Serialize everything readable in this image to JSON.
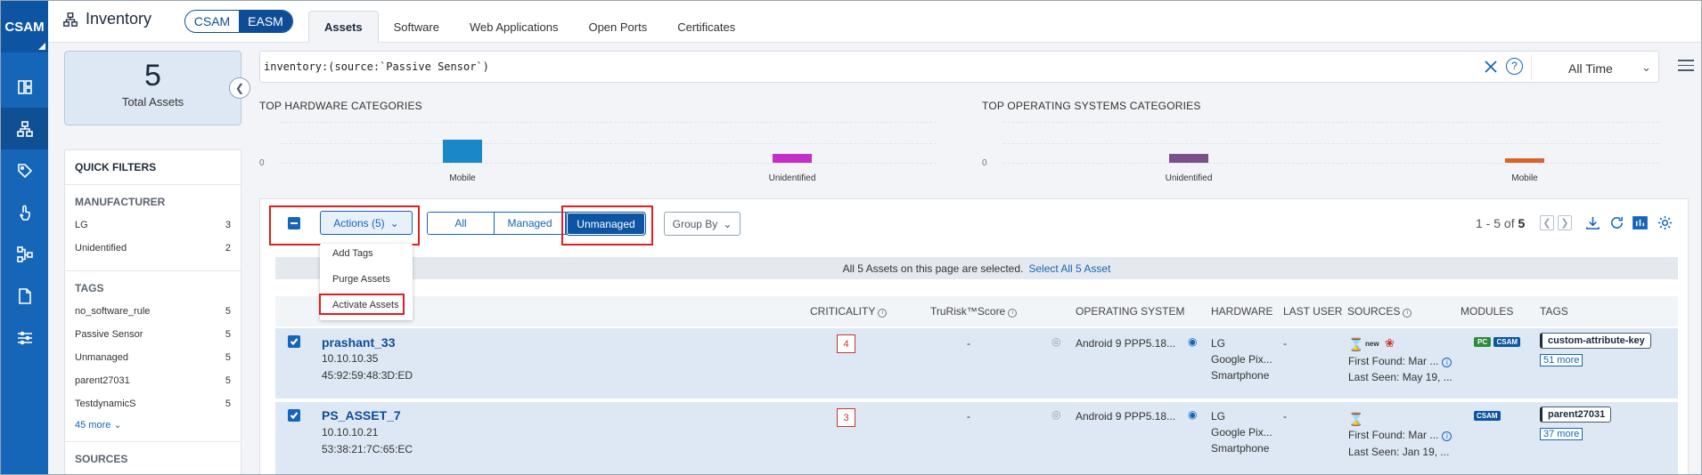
{
  "rail": {
    "logo": "CSAM"
  },
  "header": {
    "title": "Inventory",
    "mode": {
      "csam": "CSAM",
      "easm": "EASM"
    },
    "tabs": [
      "Assets",
      "Software",
      "Web Applications",
      "Open Ports",
      "Certificates"
    ]
  },
  "summary": {
    "total": "5",
    "total_label": "Total Assets"
  },
  "search": {
    "query": "inventory:(source:`Passive Sensor`)",
    "time_range": "All Time"
  },
  "filters": {
    "title": "QUICK FILTERS",
    "manufacturer": {
      "title": "MANUFACTURER",
      "items": [
        {
          "label": "LG",
          "count": "3"
        },
        {
          "label": "Unidentified",
          "count": "2"
        }
      ]
    },
    "tags": {
      "title": "TAGS",
      "items": [
        {
          "label": "no_software_rule",
          "count": "5"
        },
        {
          "label": "Passive Sensor",
          "count": "5"
        },
        {
          "label": "Unmanaged",
          "count": "5"
        },
        {
          "label": "parent27031",
          "count": "5"
        },
        {
          "label": "TestdynamicS",
          "count": "5"
        }
      ],
      "more": "45 more"
    },
    "sources_title": "SOURCES"
  },
  "charts": {
    "hardware": {
      "title": "TOP HARDWARE CATEGORIES",
      "zero": "0",
      "bars": [
        {
          "label": "Mobile",
          "value": 3,
          "color": "#1a87c9"
        },
        {
          "label": "Unidentified",
          "value": 1.2,
          "color": "#c42fc7"
        }
      ]
    },
    "os": {
      "title": "TOP OPERATING SYSTEMS CATEGORIES",
      "zero": "0",
      "bars": [
        {
          "label": "Unidentified",
          "value": 1.2,
          "color": "#7b4f8a"
        },
        {
          "label": "Mobile",
          "value": 0.6,
          "color": "#d8642a"
        }
      ]
    }
  },
  "toolbar": {
    "actions": "Actions (5)",
    "segments": [
      "All",
      "Managed",
      "Unmanaged"
    ],
    "group_by": "Group By",
    "pager_prefix": "1 - 5 of",
    "pager_total": "5"
  },
  "actions_menu": [
    "Add Tags",
    "Purge Assets",
    "Activate Assets"
  ],
  "selection": {
    "text": "All 5 Assets on this page are selected.",
    "link": "Select All 5 Asset"
  },
  "columns": {
    "criticality": "CRITICALITY",
    "trurisk": "TruRisk™Score",
    "os": "OPERATING SYSTEM",
    "hardware": "HARDWARE",
    "last_user": "LAST USER",
    "sources": "SOURCES",
    "modules": "MODULES",
    "tags": "TAGS"
  },
  "rows": [
    {
      "name": "prashant_33",
      "ip": "10.10.10.35",
      "mac": "45:92:59:48:3D:ED",
      "criticality": "4",
      "trurisk": "-",
      "os": "Android 9 PPP5.18...",
      "hw1": "LG",
      "hw2": "Google Pix...",
      "hw3": "Smartphone",
      "last_user": "-",
      "source_new": "new",
      "first_found": "First Found: Mar ...",
      "last_seen": "Last Seen: May 19, ...",
      "modules": [
        "PC",
        "CSAM"
      ],
      "tag": "custom-attribute-key",
      "more": "51 more"
    },
    {
      "name": "PS_ASSET_7",
      "ip": "10.10.10.21",
      "mac": "53:38:21:7C:65:EC",
      "criticality": "3",
      "trurisk": "-",
      "os": "Android 9 PPP5.18...",
      "hw1": "LG",
      "hw2": "Google Pix...",
      "hw3": "Smartphone",
      "last_user": "-",
      "source_new": "",
      "first_found": "First Found: Mar ...",
      "last_seen": "Last Seen: Jan 19, ...",
      "modules": [
        "CSAM"
      ],
      "tag": "parent27031",
      "more": "37 more"
    }
  ]
}
